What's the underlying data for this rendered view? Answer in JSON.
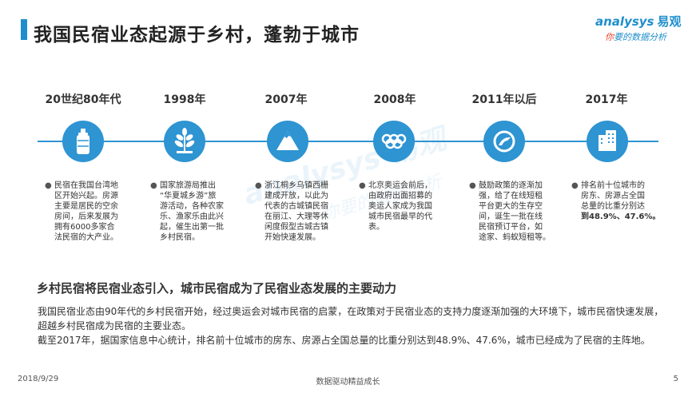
{
  "header": {
    "title": "我国民宿业态起源于乡村，蓬勃于城市",
    "logo_brand": "analysys",
    "logo_brand_cn": "易观",
    "logo_tag_accent": "你",
    "logo_tag_rest": "要的数据分析"
  },
  "timeline": {
    "events": [
      {
        "year": "20世纪80年代",
        "icon": "bottle-icon",
        "lines": [
          "民宿在我国台湾地",
          "区开始兴起。房源",
          "主要是居民的空余",
          "房间，后来发展为",
          "拥有6000多家合",
          "法民宿的大产业。"
        ]
      },
      {
        "year": "1998年",
        "icon": "wheat-icon",
        "lines": [
          "国家旅游局推出",
          "“华夏城乡游”旅",
          "游活动，各种农家",
          "乐、渔家乐由此兴",
          "起，催生出第一批",
          "乡村民宿。"
        ]
      },
      {
        "year": "2007年",
        "icon": "mountain-icon",
        "lines": [
          "浙江桐乡乌镇西栅",
          "建成开放，以此为",
          "代表的古城镇民宿",
          "在丽江、大理等休",
          "闲度假型古城古镇",
          "开始快速发展。"
        ]
      },
      {
        "year": "2008年",
        "icon": "olympic-rings-icon",
        "lines": [
          "北京奥运会前后，",
          "由政府出面招募的",
          "奥运人家成为我国",
          "城市民宿最早的代",
          "表。"
        ]
      },
      {
        "year": "2011年以后",
        "icon": "policy-icon",
        "lines": [
          "鼓励政策的逐渐加",
          "强，给了在线短租",
          "平台更大的生存空",
          "间，诞生一批在线",
          "民宿预订平台，如",
          "途家、蚂蚁短租等。"
        ]
      },
      {
        "year": "2017年",
        "icon": "building-icon",
        "lines": [
          "排名前十位城市的",
          "房东、房源占全国",
          "总量的比重分别达",
          "到48.9%、47.6%。"
        ]
      }
    ]
  },
  "summary": {
    "heading": "乡村民宿将民宿业态引入，城市民宿成为了民宿业态发展的主要动力",
    "para1": "我国民宿业态由90年代的乡村民宿开始，经过奥运会对城市民宿的启蒙，在政策对于民宿业态的支持力度逐渐加强的大环境下，城市民宿快速发展，超越乡村民宿成为民宿的主要业态。",
    "para2": "截至2017年，据国家信息中心统计，排名前十位城市的房东、房源占全国总量的比重分别达到48.9%、47.6%，城市已经成为了民宿的主阵地。"
  },
  "footer": {
    "date": "2018/9/29",
    "center": "数据驱动精益成长",
    "page": "5"
  },
  "colors": {
    "accent": "#2e94d2",
    "title_bar": "#1f8ecd",
    "logo_red": "#e8452c"
  }
}
